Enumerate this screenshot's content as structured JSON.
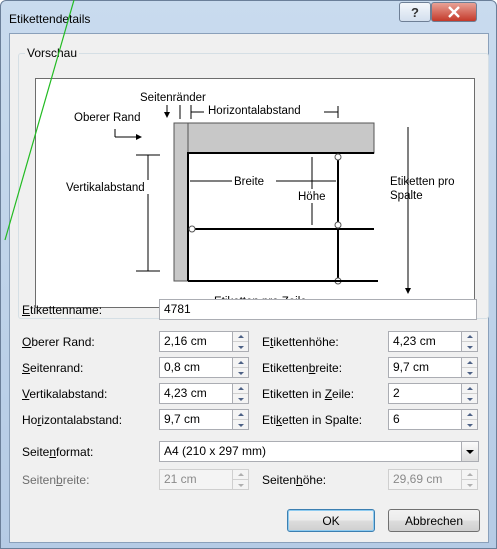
{
  "window": {
    "title": "Etikettendetails"
  },
  "titlebar": {
    "help_label": "?"
  },
  "preview": {
    "group_label": "Vorschau",
    "labels": {
      "seitenraender": "Seitenränder",
      "oberer_rand": "Oberer Rand",
      "horizontalabstand": "Horizontalabstand",
      "vertikalabstand": "Vertikalabstand",
      "breite": "Breite",
      "hoehe": "Höhe",
      "etiketten_pro_spalte_1": "Etiketten pro",
      "etiketten_pro_spalte_2": "Spalte",
      "etiketten_pro_zeile": "Etiketten pro Zeile"
    }
  },
  "form": {
    "etikettenname": {
      "label_pre": "",
      "label_acc": "E",
      "label_post": "tikettenname:",
      "value": "4781"
    },
    "oberer_rand": {
      "label_pre": "",
      "label_acc": "O",
      "label_post": "berer Rand:",
      "value": "2,16 cm"
    },
    "seitenrand": {
      "label_pre": "",
      "label_acc": "S",
      "label_post": "eitenrand:",
      "value": "0,8 cm"
    },
    "vertikalabstand": {
      "label_pre": "",
      "label_acc": "V",
      "label_post": "ertikalabstand:",
      "value": "4,23 cm"
    },
    "horizontalabstand": {
      "label_pre": "Ho",
      "label_acc": "r",
      "label_post": "izontalabstand:",
      "value": "9,7 cm"
    },
    "etikettenhoehe": {
      "label_pre": "E",
      "label_acc": "t",
      "label_post": "ikettenhöhe:",
      "value": "4,23 cm"
    },
    "etikettenbreite": {
      "label_pre": "Etiketten",
      "label_acc": "b",
      "label_post": "reite:",
      "value": "9,7 cm"
    },
    "etiketten_in_zeile": {
      "label_pre": "Etiketten in ",
      "label_acc": "Z",
      "label_post": "eile:",
      "value": "2"
    },
    "etiketten_in_spalte": {
      "label_pre": "Eti",
      "label_acc": "k",
      "label_post": "etten in Spalte:",
      "value": "6"
    },
    "seitenformat": {
      "label_pre": "Seite",
      "label_acc": "n",
      "label_post": "format:",
      "value": "A4 (210 x 297 mm)"
    },
    "seitenbreite": {
      "label_pre": "Seiten",
      "label_acc": "b",
      "label_post": "reite:",
      "value": "21 cm"
    },
    "seitenhoehe": {
      "label_pre": "Seiten",
      "label_acc": "h",
      "label_post": "öhe:",
      "value": "29,69 cm"
    }
  },
  "buttons": {
    "ok": "OK",
    "cancel": "Abbrechen"
  },
  "colors": {
    "annotation_line": "#22bb22",
    "close_button": "#c4392a",
    "preview_gray": "#c8c8c8"
  }
}
